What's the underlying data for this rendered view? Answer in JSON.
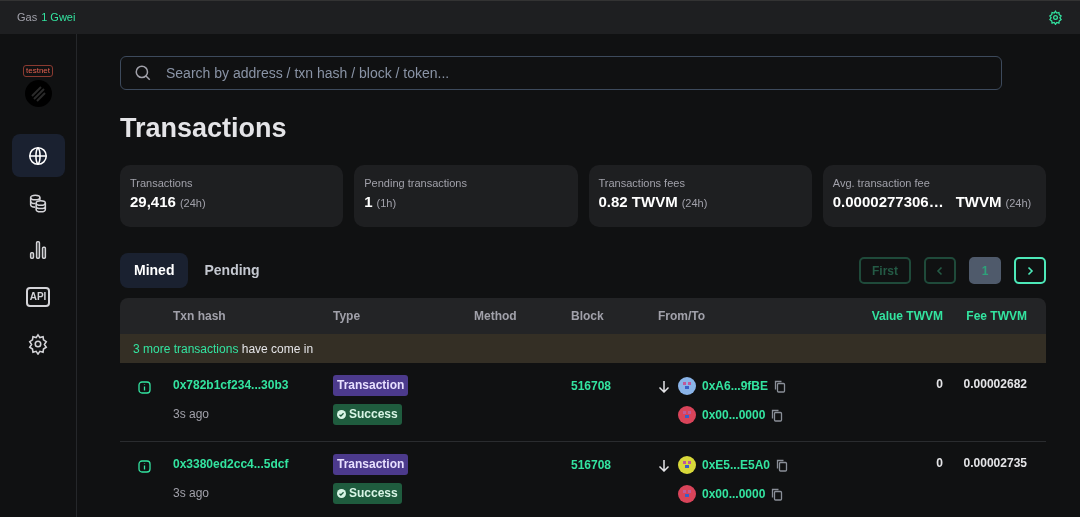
{
  "top_bar": {
    "gas_label": "Gas",
    "gas_value": "1 Gwei"
  },
  "sidebar": {
    "network_badge": "testnet",
    "items": [
      {
        "kind": "globe",
        "selected": true
      },
      {
        "kind": "coins",
        "selected": false
      },
      {
        "kind": "chart",
        "selected": false
      },
      {
        "kind": "api",
        "label": "API",
        "selected": false
      },
      {
        "kind": "settings",
        "selected": false
      }
    ]
  },
  "search": {
    "placeholder": "Search by address / txn hash / block / token..."
  },
  "title": "Transactions",
  "stats": [
    {
      "label": "Transactions",
      "value": "29,416",
      "period": "(24h)"
    },
    {
      "label": "Pending transactions",
      "value": "1",
      "period": "(1h)"
    },
    {
      "label": "Transactions fees",
      "value": "0.82 TWVM",
      "period": "(24h)"
    },
    {
      "label": "Avg. transaction fee",
      "value": "0.0000277306…",
      "unit": "TWVM",
      "period": "(24h)"
    }
  ],
  "tabs": [
    {
      "label": "Mined",
      "selected": true
    },
    {
      "label": "Pending",
      "selected": false
    }
  ],
  "pagination": [
    {
      "kind": "first",
      "label": "First",
      "disabled": true
    },
    {
      "kind": "prev",
      "disabled": true
    },
    {
      "kind": "page",
      "label": "1",
      "selected": true
    },
    {
      "kind": "next",
      "disabled": false
    }
  ],
  "table": {
    "columns": [
      "Txn hash",
      "Type",
      "Method",
      "Block",
      "From/To",
      "Value TWVM",
      "Fee TWVM"
    ],
    "notice": {
      "link": "3 more transactions",
      "text": "have come in"
    },
    "rows": [
      {
        "hash": "0x782b1cf234...30b3",
        "age": "3s ago",
        "type": "Transaction",
        "status": "Success",
        "block": "516708",
        "from": {
          "address": "0xA6...9fBE",
          "color": "#8ab4e8"
        },
        "to": {
          "address": "0x00...0000",
          "color": "#d9445a"
        },
        "value": "0",
        "fee": "0.00002682"
      },
      {
        "hash": "0x3380ed2cc4...5dcf",
        "age": "3s ago",
        "type": "Transaction",
        "status": "Success",
        "block": "516708",
        "from": {
          "address": "0xE5...E5A0",
          "color": "#d8d83a"
        },
        "to": {
          "address": "0x00...0000",
          "color": "#d9445a"
        },
        "value": "0",
        "fee": "0.00002735"
      }
    ]
  }
}
